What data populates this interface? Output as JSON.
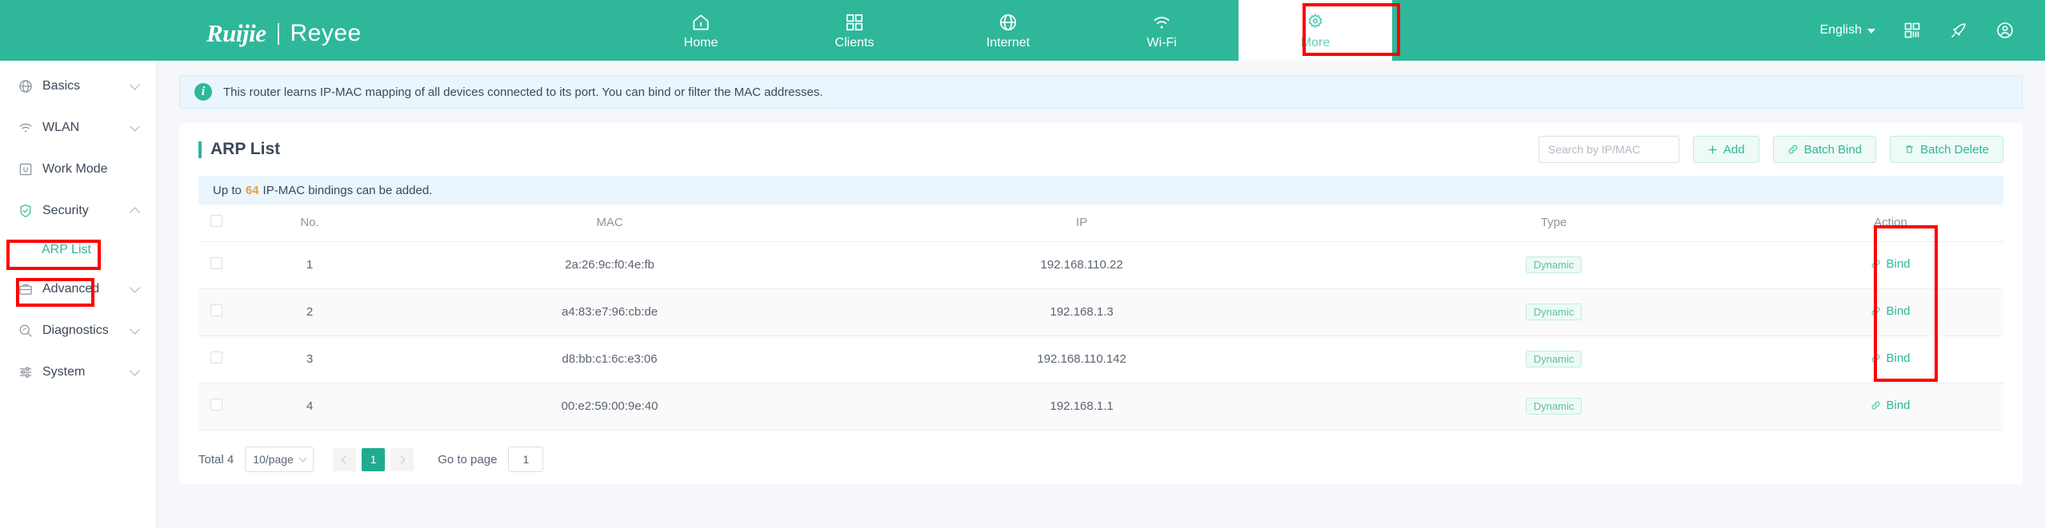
{
  "header": {
    "logo_primary": "Ruijie",
    "logo_secondary": "Reyee",
    "nav": [
      {
        "label": "Home",
        "icon": "home-icon",
        "active": false
      },
      {
        "label": "Clients",
        "icon": "grid-icon",
        "active": false
      },
      {
        "label": "Internet",
        "icon": "globe-icon",
        "active": false
      },
      {
        "label": "Wi-Fi",
        "icon": "wifi-icon",
        "active": false
      },
      {
        "label": "More",
        "icon": "gear-icon",
        "active": true
      }
    ],
    "language": "English",
    "icons": [
      "qrcode-icon",
      "rocket-icon",
      "user-account-icon"
    ],
    "accent": "#2fb79a",
    "highlight_color": "#ff0000"
  },
  "sidebar": {
    "items": [
      {
        "label": "Basics",
        "icon": "globe-icon",
        "expandable": true,
        "expanded": false,
        "active": false
      },
      {
        "label": "WLAN",
        "icon": "wifi-icon",
        "expandable": true,
        "expanded": false,
        "active": false
      },
      {
        "label": "Work Mode",
        "icon": "workmode-icon",
        "expandable": false,
        "expanded": false,
        "active": false
      },
      {
        "label": "Security",
        "icon": "shield-icon",
        "expandable": true,
        "expanded": true,
        "active": false
      },
      {
        "label": "Advanced",
        "icon": "briefcase-icon",
        "expandable": true,
        "expanded": false,
        "active": false
      },
      {
        "label": "Diagnostics",
        "icon": "diagnostics-icon",
        "expandable": true,
        "expanded": false,
        "active": false
      },
      {
        "label": "System",
        "icon": "sliders-icon",
        "expandable": true,
        "expanded": false,
        "active": false
      }
    ],
    "sub_item": {
      "label": "ARP List",
      "active": true
    }
  },
  "banner": {
    "icon": "info-icon",
    "text": "This router learns IP-MAC mapping of all devices connected to its port. You can bind or filter the MAC addresses."
  },
  "card": {
    "title": "ARP List",
    "search": {
      "placeholder": "Search by IP/MAC",
      "value": ""
    },
    "buttons": {
      "add": "Add",
      "batch_bind": "Batch Bind",
      "batch_delete": "Batch Delete"
    },
    "note": {
      "prefix": "Up to",
      "limit": "64",
      "suffix": "IP-MAC bindings can be added."
    }
  },
  "table": {
    "columns": [
      "No.",
      "MAC",
      "IP",
      "Type",
      "Action"
    ],
    "rows": [
      {
        "no": "1",
        "mac": "2a:26:9c:f0:4e:fb",
        "ip": "192.168.110.22",
        "type": "Dynamic",
        "action": "Bind",
        "checked": false
      },
      {
        "no": "2",
        "mac": "a4:83:e7:96:cb:de",
        "ip": "192.168.1.3",
        "type": "Dynamic",
        "action": "Bind",
        "checked": false
      },
      {
        "no": "3",
        "mac": "d8:bb:c1:6c:e3:06",
        "ip": "192.168.110.142",
        "type": "Dynamic",
        "action": "Bind",
        "checked": false
      },
      {
        "no": "4",
        "mac": "00:e2:59:00:9e:40",
        "ip": "192.168.1.1",
        "type": "Dynamic",
        "action": "Bind",
        "checked": false
      }
    ]
  },
  "pagination": {
    "total": "Total 4",
    "page_size": "10/page",
    "current_page": "1",
    "goto_label": "Go to page",
    "goto_value": "1"
  }
}
